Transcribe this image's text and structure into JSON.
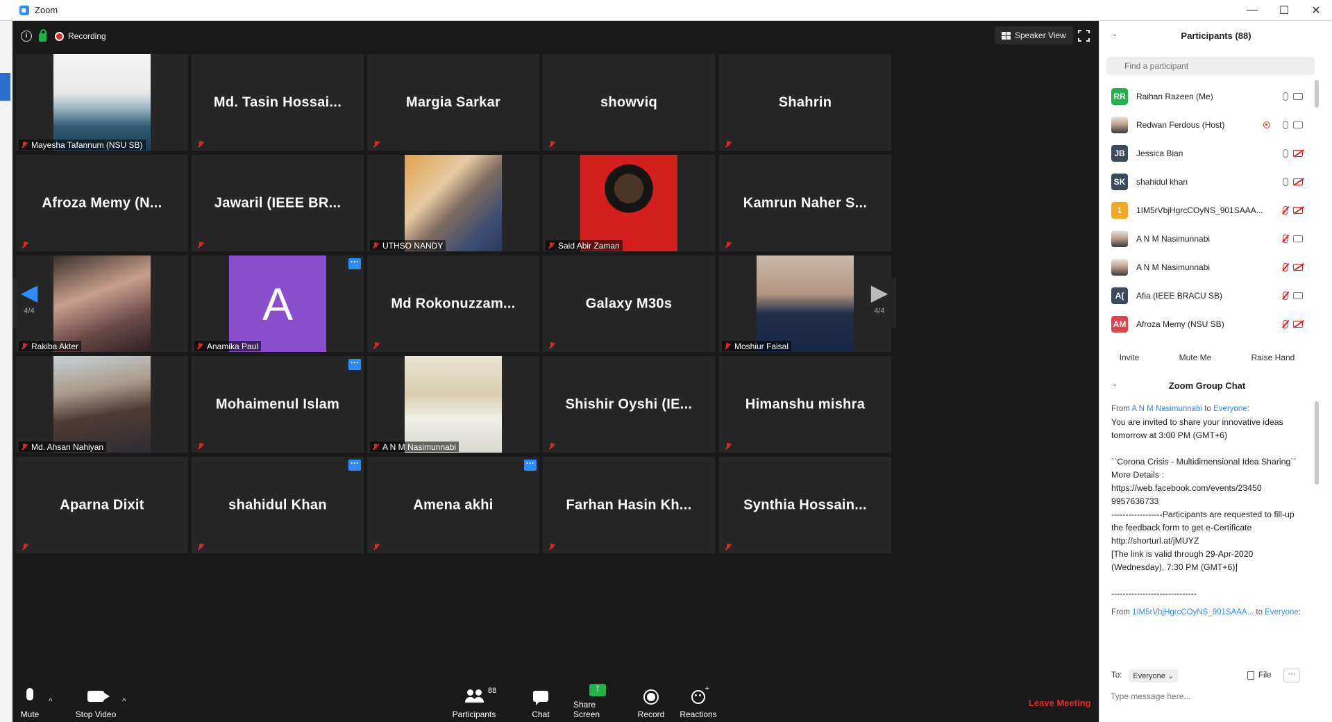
{
  "window": {
    "title": "Zoom",
    "minimize": "—",
    "maximize": "☐",
    "close": "✕"
  },
  "topbar": {
    "recording": "Recording",
    "speaker_view": "Speaker View"
  },
  "tiles": [
    {
      "name": "Mayesha Tafannum (NSU SB)",
      "photo": "ph-a"
    },
    {
      "name": "Md. Tasin Hossai..."
    },
    {
      "name": "Margia Sarkar"
    },
    {
      "name": "showviq"
    },
    {
      "name": "Shahrin"
    },
    {
      "name": "Afroza Memy (N..."
    },
    {
      "name": "Jawaril (IEEE BR..."
    },
    {
      "name": "UTHSO NANDY",
      "photo": "ph-b"
    },
    {
      "name": "Said Abir Zaman",
      "photo": "ph-c"
    },
    {
      "name": "Kamrun Naher S..."
    },
    {
      "name": "Rakiba Akter",
      "photo": "ph-d"
    },
    {
      "name": "Anamika Paul",
      "photo": "ph-e",
      "letter": "A",
      "more": true
    },
    {
      "name": "Md  Rokonuzzam..."
    },
    {
      "name": "Galaxy M30s"
    },
    {
      "name": "Moshiur Faisal",
      "photo": "ph-f"
    },
    {
      "name": "Md. Ahsan Nahiyan",
      "photo": "ph-g"
    },
    {
      "name": "Mohaimenul Islam",
      "more": true
    },
    {
      "name": "A N M Nasimunnabi",
      "photo": "ph-h"
    },
    {
      "name": "Shishir Oyshi (IE..."
    },
    {
      "name": "Himanshu mishra"
    },
    {
      "name": "Aparna Dixit"
    },
    {
      "name": "shahidul Khan",
      "more": true
    },
    {
      "name": "Amena akhi",
      "more": true
    },
    {
      "name": "Farhan Hasin Kh..."
    },
    {
      "name": "Synthia  Hossain..."
    }
  ],
  "nav": {
    "page": "4/4",
    "left_arrow": "◀",
    "right_arrow": "▶"
  },
  "toolbar": {
    "mute": "Mute",
    "stop_video": "Stop Video",
    "participants": "Participants",
    "participants_count": "88",
    "chat": "Chat",
    "share_screen": "Share Screen",
    "record": "Record",
    "reactions": "Reactions",
    "leave": "Leave Meeting",
    "caret": "^"
  },
  "participants_panel": {
    "title": "Participants (88)",
    "search_placeholder": "Find a participant",
    "list": [
      {
        "initials": "RR",
        "color": "#23b14d",
        "name": "Raihan Razeen (Me)",
        "mic": "on",
        "cam": "on"
      },
      {
        "initials": "",
        "color": "",
        "name": "Redwan Ferdous (Host)",
        "mic": "on",
        "cam": "on",
        "rec": true,
        "img": true
      },
      {
        "initials": "JB",
        "color": "#3a4a5c",
        "name": "Jessica Bian",
        "mic": "on",
        "cam": "off"
      },
      {
        "initials": "SK",
        "color": "#3a4a5c",
        "name": "shahidul khan",
        "mic": "on",
        "cam": "off"
      },
      {
        "initials": "1",
        "color": "#f5a623",
        "name": "1IM5rVbjHgrcCOyNS_901SAAA...",
        "mic": "off",
        "cam": "off"
      },
      {
        "initials": "",
        "color": "",
        "name": "A N M Nasimunnabi",
        "mic": "off",
        "cam": "on",
        "img": true
      },
      {
        "initials": "",
        "color": "",
        "name": "A N M Nasimunnabi",
        "mic": "off",
        "cam": "off",
        "img": true
      },
      {
        "initials": "A(",
        "color": "#3a4a5c",
        "name": "Afia (IEEE BRACU SB)",
        "mic": "off",
        "cam": "on"
      },
      {
        "initials": "AM",
        "color": "#e0424a",
        "name": "Afroza Memy (NSU SB)",
        "mic": "off",
        "cam": "off"
      }
    ],
    "invite": "Invite",
    "mute_me": "Mute Me",
    "raise_hand": "Raise Hand"
  },
  "chat": {
    "title": "Zoom Group Chat",
    "from_label": "From",
    "to_label": "to",
    "sender": "A N M Nasimunnabi",
    "recipient": "Everyone",
    "message": "You are invited to share your innovative ideas tomorrow at 3:00 PM (GMT+6)\n\n``Corona Crisis - Multidimensional Idea Sharing``\nMore Details :\nhttps://web.facebook.com/events/23450 9957636733\n------------------Participants are requested to fill-up the feedback form to get e-Certificate\nhttp://shorturl.at/jMUYZ\n[The link is valid through 29-Apr-2020 (Wednesday), 7:30 PM (GMT+6)]\n\n------------------------------",
    "next_sender": "1IM5rVbjHgrcCOyNS_901SAAA...",
    "to_select_label": "To:",
    "to_select_value": "Everyone",
    "file": "File",
    "more": "···",
    "input_placeholder": "Type message here..."
  }
}
